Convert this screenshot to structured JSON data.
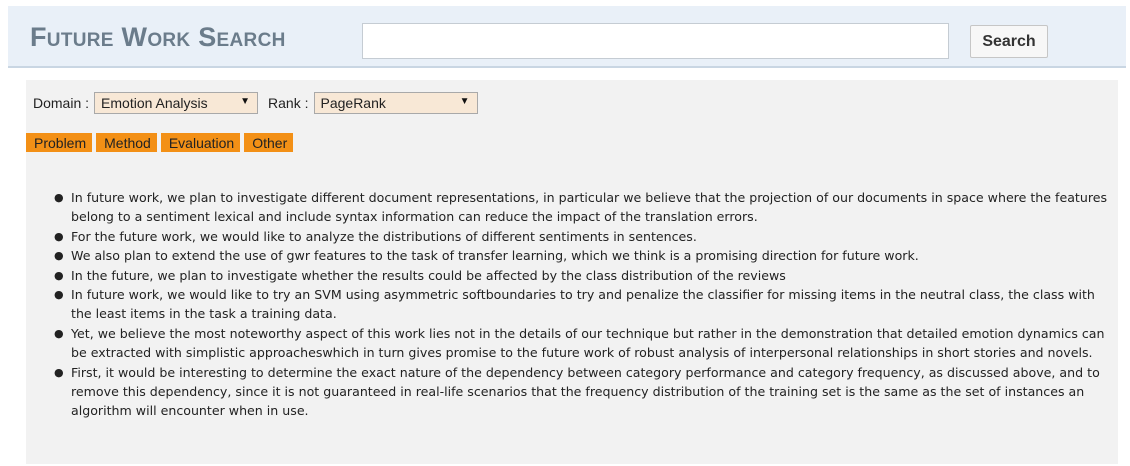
{
  "header": {
    "title": "Future Work Search",
    "search": {
      "value": "",
      "placeholder": ""
    },
    "search_button_label": "Search"
  },
  "filters": {
    "domain_label": "Domain :",
    "domain_value": "Emotion Analysis",
    "rank_label": "Rank :",
    "rank_value": "PageRank"
  },
  "tabs": [
    {
      "label": "Problem"
    },
    {
      "label": "Method"
    },
    {
      "label": "Evaluation"
    },
    {
      "label": "Other"
    }
  ],
  "results": [
    "In future work, we plan to investigate different document representations, in particular we believe that the projection of our documents in space where the features belong to a sentiment lexical and include syntax information can reduce the impact of the translation errors.",
    "For the future work, we would like to analyze the distributions of different sentiments in sentences.",
    "We also plan to extend the use of gwr features to the task of transfer learning, which we think is a promising direction for future work.",
    "In the future, we plan to investigate whether the results could be affected by the class distribution of the reviews",
    "In future work, we would like to try an SVM using asymmetric softboundaries to try and penalize the classifier for missing items in the neutral class, the class with the least items in the task a training data.",
    "Yet, we believe the most noteworthy aspect of this work lies not in the details of our technique but rather in the demonstration that detailed emotion dynamics can be extracted with simplistic approacheswhich in turn gives promise to the future work of robust analysis of interpersonal relationships in short stories and novels.",
    "First, it would be interesting to determine the exact nature of the dependency between category performance and category frequency, as discussed above, and to remove this dependency, since it is not guaranteed in real-life scenarios that the frequency distribution of the training set is the same as the set of instances an algorithm will encounter when in use."
  ],
  "colors": {
    "header_bg": "#e9f0f8",
    "tab_bg": "#f39016",
    "select_bg": "#f8e8d6",
    "content_bg": "#f2f2f2"
  },
  "icons": {
    "dropdown": "triangle-down"
  }
}
